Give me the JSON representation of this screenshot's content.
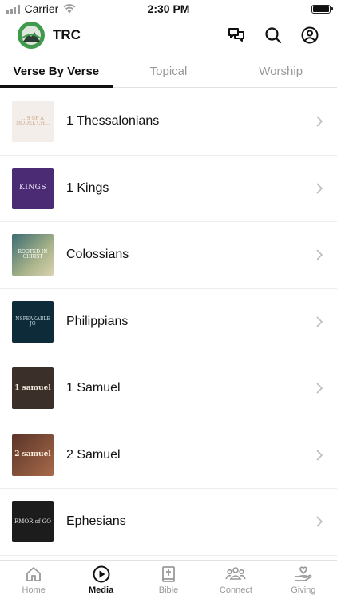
{
  "status_bar": {
    "carrier": "Carrier",
    "time": "2:30 PM"
  },
  "header": {
    "title": "TRC",
    "icons": [
      "chat-icon",
      "search-icon",
      "profile-icon"
    ],
    "accent_color": "#3f9a4e"
  },
  "tabs": [
    {
      "label": "Verse By Verse",
      "active": true
    },
    {
      "label": "Topical",
      "active": false
    },
    {
      "label": "Worship",
      "active": false
    }
  ],
  "series": [
    {
      "title": "1 Thessalonians",
      "thumb_text": "…S OF A MODEL CH…"
    },
    {
      "title": "1 Kings",
      "thumb_text": "KINGS"
    },
    {
      "title": "Colossians",
      "thumb_text": "ROOTED IN CHRIST"
    },
    {
      "title": "Philippians",
      "thumb_text": "NSPEAKABLE JO"
    },
    {
      "title": "1 Samuel",
      "thumb_text": "1 samuel"
    },
    {
      "title": "2 Samuel",
      "thumb_text": "2 samuel"
    },
    {
      "title": "Ephesians",
      "thumb_text": "RMOR of GO"
    }
  ],
  "bottom_nav": [
    {
      "label": "Home",
      "icon": "home-icon",
      "active": false
    },
    {
      "label": "Media",
      "icon": "play-circle-icon",
      "active": true
    },
    {
      "label": "Bible",
      "icon": "bible-icon",
      "active": false
    },
    {
      "label": "Connect",
      "icon": "group-icon",
      "active": false
    },
    {
      "label": "Giving",
      "icon": "giving-hand-icon",
      "active": false
    }
  ]
}
